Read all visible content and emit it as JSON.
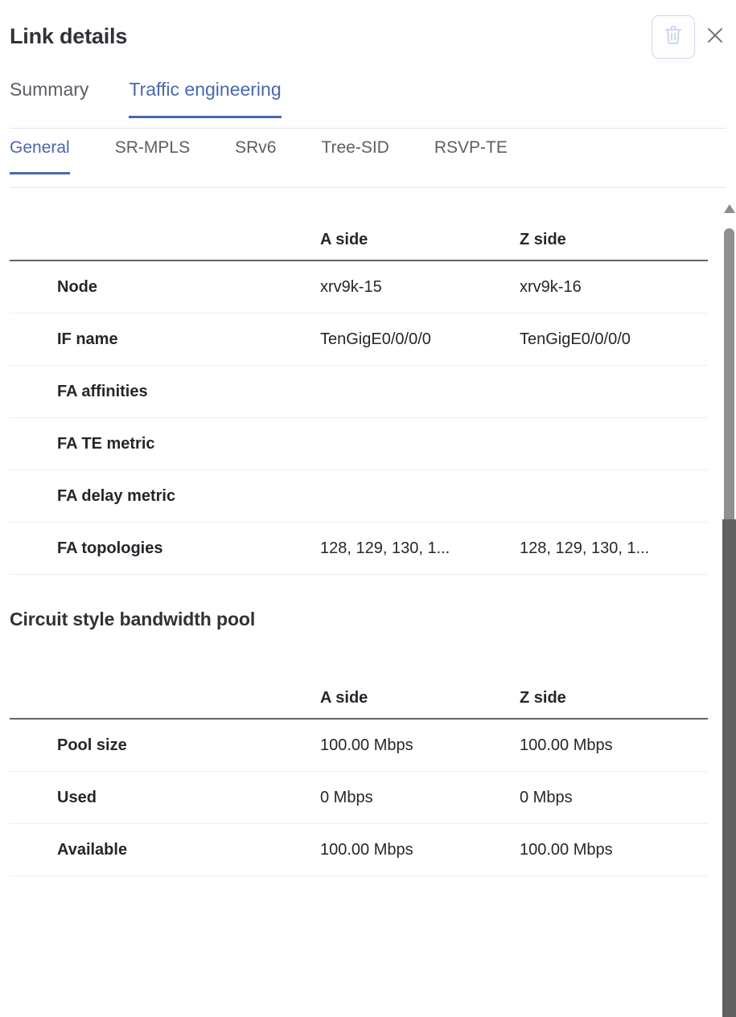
{
  "header": {
    "title": "Link details",
    "delete_icon": "trash-icon",
    "close_icon": "close-icon"
  },
  "primary_tabs": [
    {
      "label": "Summary",
      "active": false
    },
    {
      "label": "Traffic engineering",
      "active": true
    }
  ],
  "secondary_tabs": [
    {
      "label": "General",
      "active": true
    },
    {
      "label": "SR-MPLS",
      "active": false
    },
    {
      "label": "SRv6",
      "active": false
    },
    {
      "label": "Tree-SID",
      "active": false
    },
    {
      "label": "RSVP-TE",
      "active": false
    }
  ],
  "general_table": {
    "columns": [
      "",
      "A side",
      "Z side"
    ],
    "rows": [
      {
        "label": "Node",
        "a": "xrv9k-15",
        "z": "xrv9k-16"
      },
      {
        "label": "IF name",
        "a": "TenGigE0/0/0/0",
        "z": "TenGigE0/0/0/0"
      },
      {
        "label": "FA affinities",
        "a": "",
        "z": ""
      },
      {
        "label": "FA TE metric",
        "a": "",
        "z": ""
      },
      {
        "label": "FA delay metric",
        "a": "",
        "z": ""
      },
      {
        "label": "FA topologies",
        "a": "128, 129, 130, 1...",
        "z": "128, 129, 130, 1..."
      }
    ]
  },
  "bandwidth_section": {
    "title": "Circuit style bandwidth pool",
    "columns": [
      "",
      "A side",
      "Z side"
    ],
    "rows": [
      {
        "label": "Pool size",
        "a": "100.00 Mbps",
        "z": "100.00 Mbps"
      },
      {
        "label": "Used",
        "a": "0 Mbps",
        "z": "0 Mbps"
      },
      {
        "label": "Available",
        "a": "100.00 Mbps",
        "z": "100.00 Mbps"
      }
    ]
  },
  "scrollbar": {
    "up_arrow_icon": "triangle-up-icon"
  },
  "colors": {
    "accent": "#4a68b0",
    "text": "#23272b",
    "muted": "#5a5f66",
    "rule": "#5f646b",
    "row_rule": "#eceef0",
    "icon_border": "#ccd7ef"
  }
}
